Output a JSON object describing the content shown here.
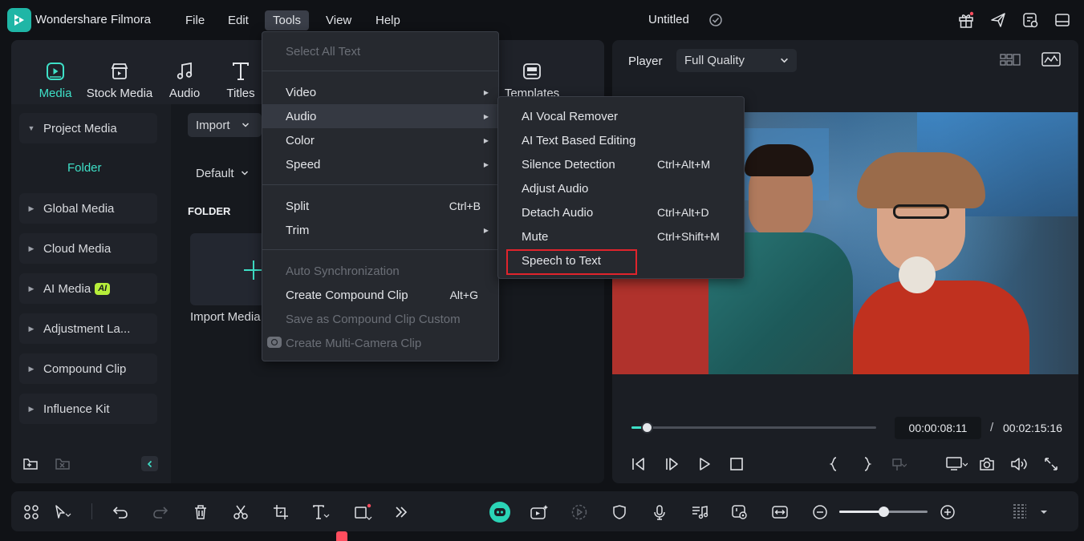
{
  "titlebar": {
    "app_name": "Wondershare Filmora",
    "menus": [
      "File",
      "Edit",
      "Tools",
      "View",
      "Help"
    ],
    "project_title": "Untitled"
  },
  "media_tabs": [
    {
      "label": "Media",
      "icon": "media-icon",
      "active": true
    },
    {
      "label": "Stock Media",
      "icon": "stock-media-icon"
    },
    {
      "label": "Audio",
      "icon": "music-note-icon"
    },
    {
      "label": "Titles",
      "icon": "titles-icon"
    },
    {
      "label": "Templates",
      "icon": "templates-icon"
    }
  ],
  "sidebar": {
    "project_media": "Project Media",
    "folder": "Folder",
    "items": [
      "Global Media",
      "Cloud Media",
      "AI Media",
      "Adjustment La...",
      "Compound Clip",
      "Influence Kit"
    ],
    "ai_badge": "AI"
  },
  "content": {
    "import_label": "Import",
    "sort_label": "Default",
    "folder_heading": "FOLDER",
    "import_media": "Import Media"
  },
  "player": {
    "label": "Player",
    "quality": "Full Quality",
    "current_time": "00:00:08:11",
    "separator": "/",
    "total_time": "00:02:15:16",
    "progress": 0.062
  },
  "tools_menu": {
    "items": [
      {
        "label": "Select All Text",
        "disabled": true
      },
      {
        "label": "Video",
        "submenu": true
      },
      {
        "label": "Audio",
        "submenu": true,
        "hover": true
      },
      {
        "label": "Color",
        "submenu": true
      },
      {
        "label": "Speed",
        "submenu": true
      },
      {
        "label": "Split",
        "shortcut": "Ctrl+B"
      },
      {
        "label": "Trim",
        "submenu": true
      },
      {
        "label": "Auto Synchronization",
        "disabled": true
      },
      {
        "label": "Create Compound Clip",
        "shortcut": "Alt+G"
      },
      {
        "label": "Save as Compound Clip Custom",
        "disabled": true
      },
      {
        "label": "Create Multi-Camera Clip",
        "disabled": true
      }
    ]
  },
  "audio_menu": {
    "items": [
      {
        "label": "AI Vocal Remover",
        "shortcut": ""
      },
      {
        "label": "AI Text Based Editing",
        "shortcut": ""
      },
      {
        "label": "Silence Detection",
        "shortcut": "Ctrl+Alt+M"
      },
      {
        "label": "Adjust Audio",
        "shortcut": ""
      },
      {
        "label": "Detach Audio",
        "shortcut": "Ctrl+Alt+D"
      },
      {
        "label": "Mute",
        "shortcut": "Ctrl+Shift+M"
      },
      {
        "label": "Speech to Text",
        "shortcut": "",
        "highlighted": true
      }
    ]
  },
  "timeline": {
    "zoom_level": 0.5
  },
  "colors": {
    "accent": "#3ee0c7",
    "highlight_border": "#e0242c",
    "menu_bg": "#26292f"
  }
}
